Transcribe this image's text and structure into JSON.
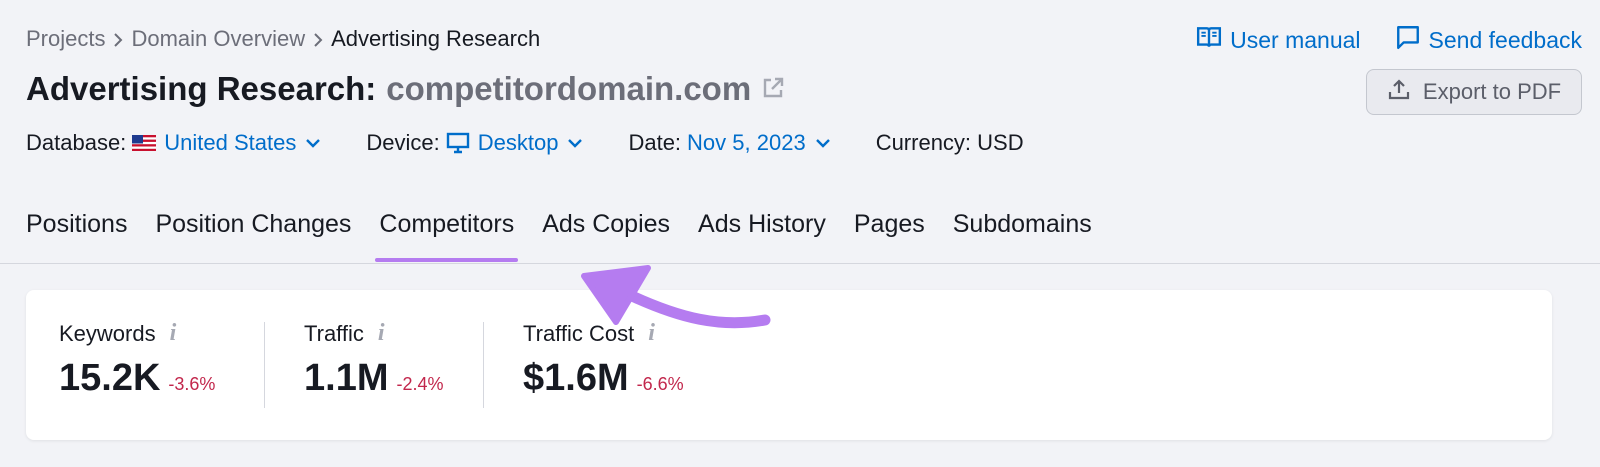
{
  "breadcrumb": {
    "items": [
      "Projects",
      "Domain Overview",
      "Advertising Research"
    ]
  },
  "top_links": {
    "manual": "User manual",
    "feedback": "Send feedback"
  },
  "title": {
    "prefix": "Advertising Research:",
    "domain": "competitordomain.com"
  },
  "export": {
    "label": "Export to PDF"
  },
  "filters": {
    "database": {
      "label": "Database:",
      "value": "United States"
    },
    "device": {
      "label": "Device:",
      "value": "Desktop"
    },
    "date": {
      "label": "Date:",
      "value": "Nov 5, 2023"
    },
    "currency": {
      "label": "Currency: USD"
    }
  },
  "tabs": [
    "Positions",
    "Position Changes",
    "Competitors",
    "Ads Copies",
    "Ads History",
    "Pages",
    "Subdomains"
  ],
  "active_tab": "Competitors",
  "stats": [
    {
      "label": "Keywords",
      "value": "15.2K",
      "delta": "-3.6%"
    },
    {
      "label": "Traffic",
      "value": "1.1M",
      "delta": "-2.4%"
    },
    {
      "label": "Traffic Cost",
      "value": "$1.6M",
      "delta": "-6.6%"
    }
  ],
  "colors": {
    "accent": "#b57cf0",
    "link": "#006dca",
    "negative": "#c2274c"
  }
}
